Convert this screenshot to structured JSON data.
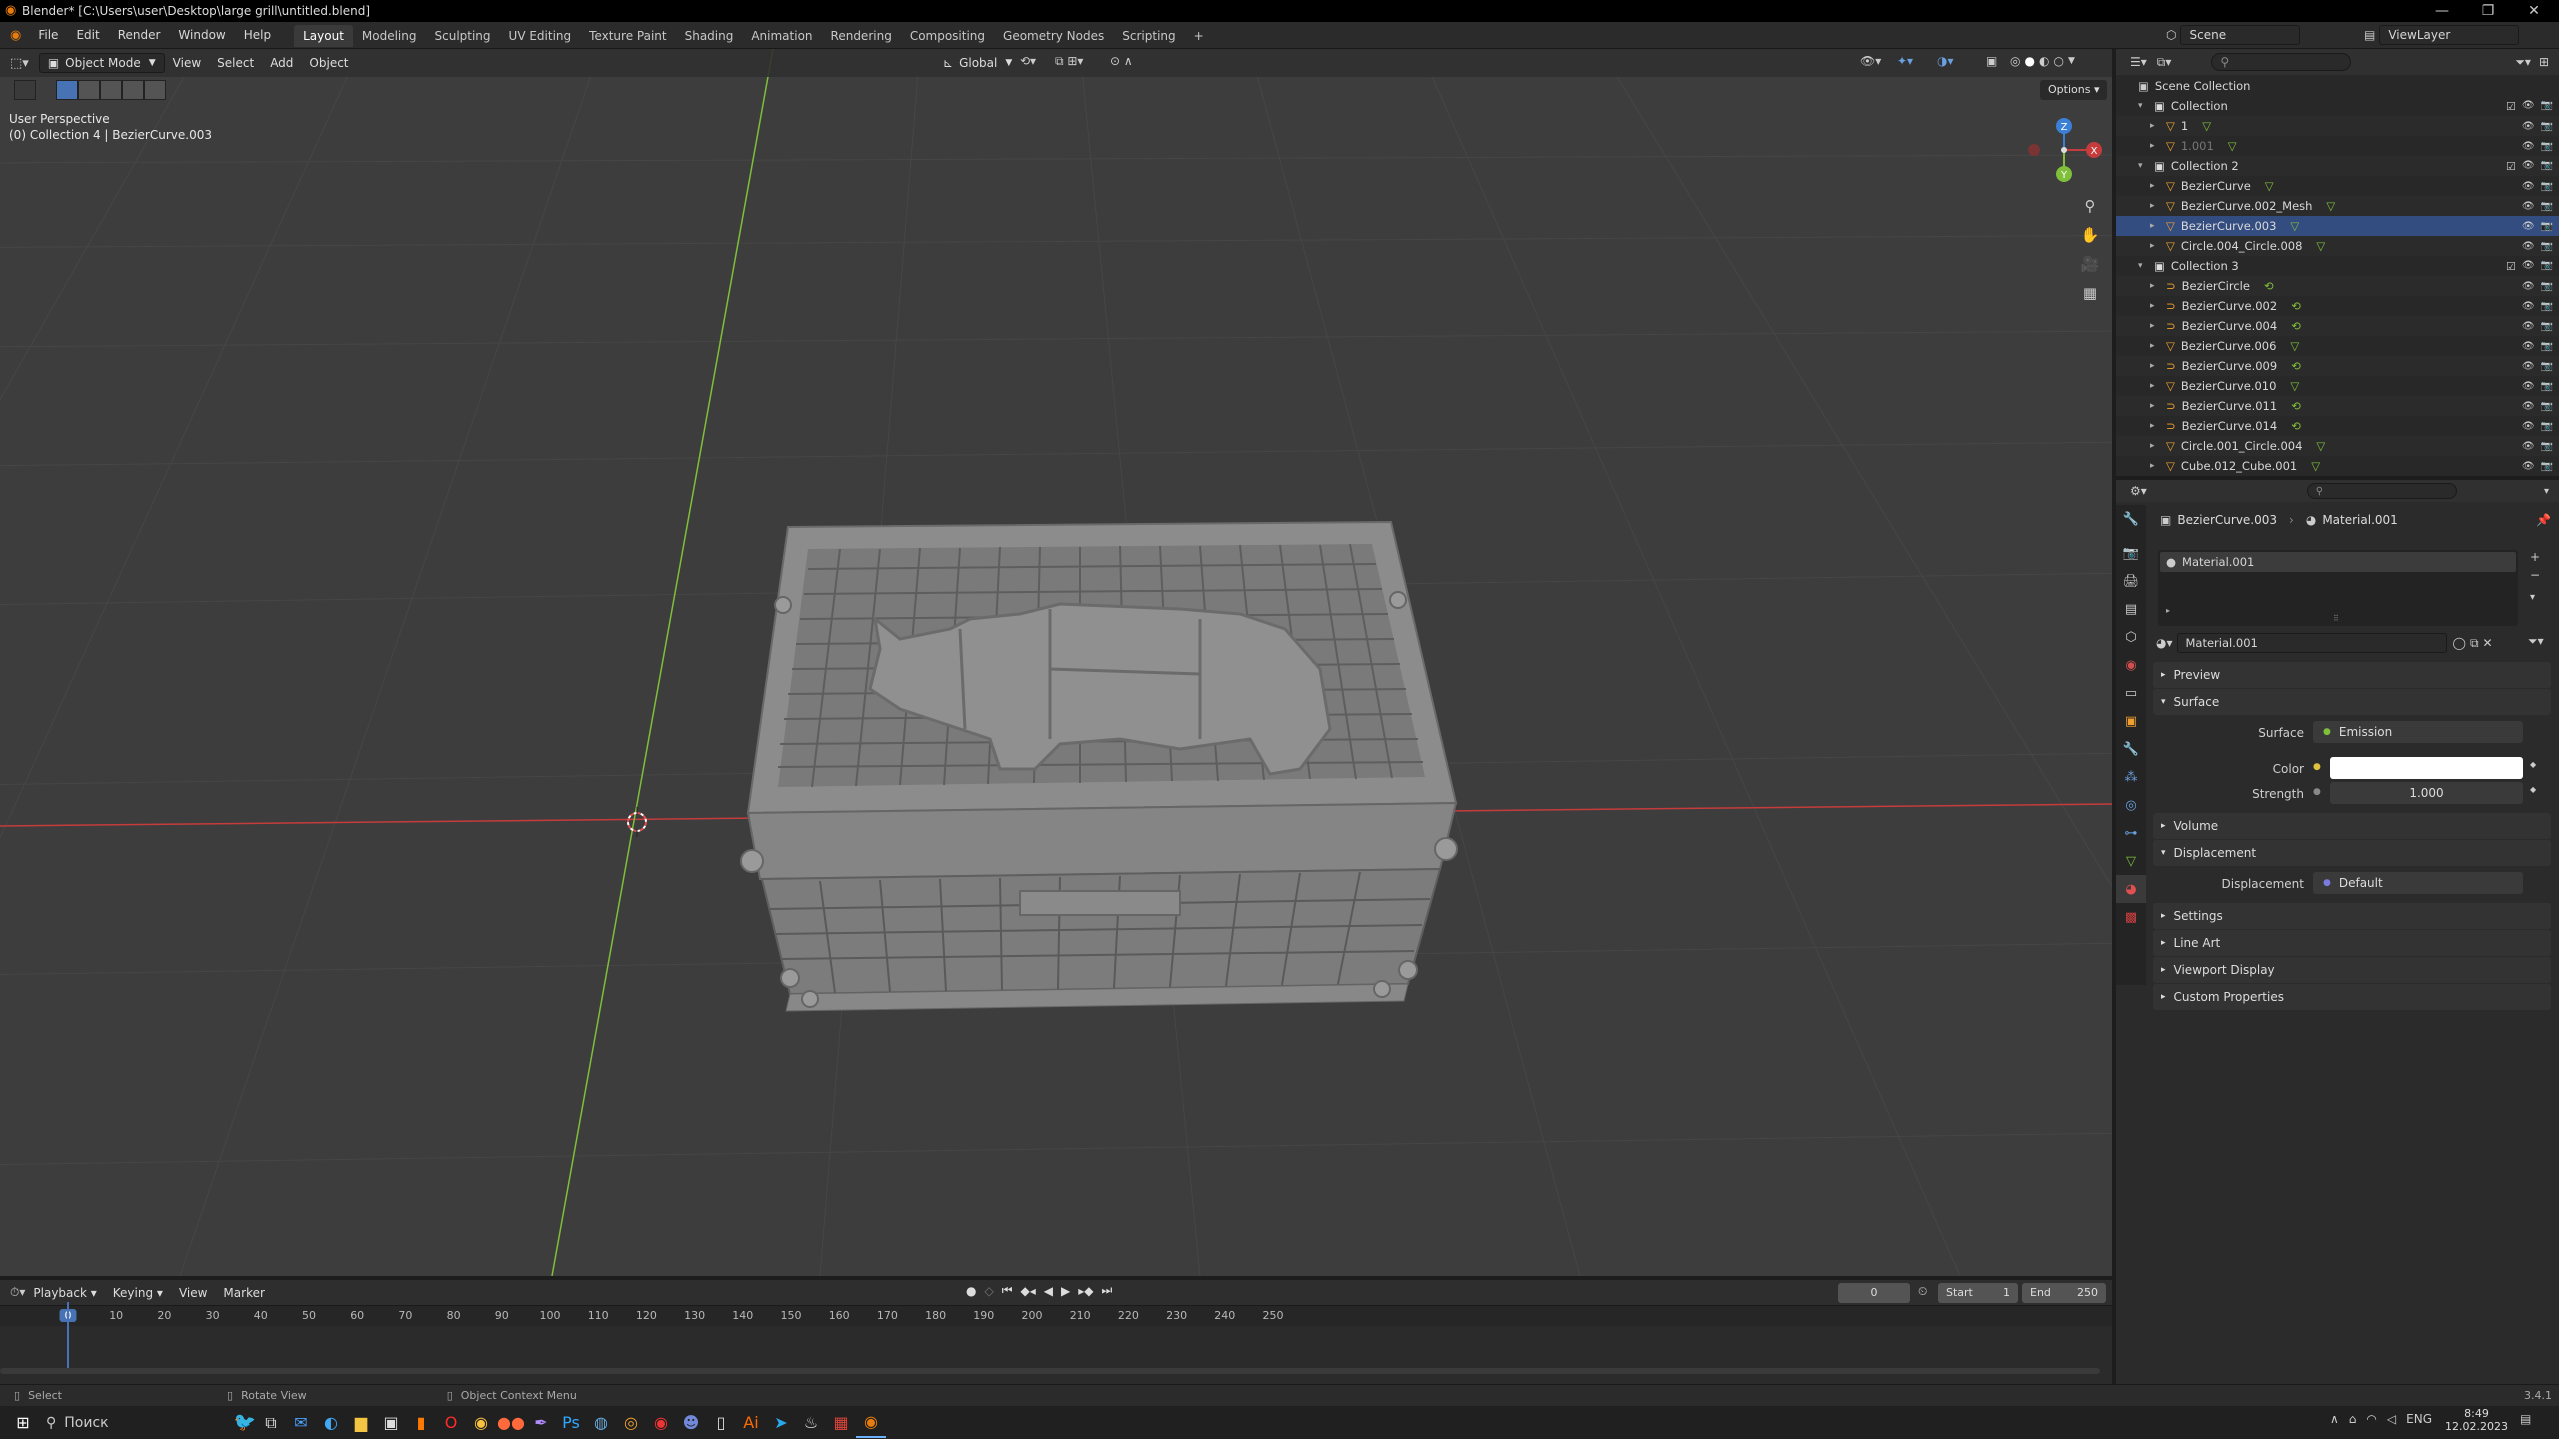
{
  "window": {
    "title": "Blender* [C:\\Users\\user\\Desktop\\large grill\\untitled.blend]"
  },
  "menu": [
    "File",
    "Edit",
    "Render",
    "Window",
    "Help"
  ],
  "workspaces": [
    "Layout",
    "Modeling",
    "Sculpting",
    "UV Editing",
    "Texture Paint",
    "Shading",
    "Animation",
    "Rendering",
    "Compositing",
    "Geometry Nodes",
    "Scripting"
  ],
  "active_workspace": "Layout",
  "scene": {
    "name": "Scene",
    "view_layer": "ViewLayer"
  },
  "viewport": {
    "mode": "Object Mode",
    "menus": [
      "View",
      "Select",
      "Add",
      "Object"
    ],
    "orientation": "Global",
    "options_label": "Options",
    "perspective_label": "User Perspective",
    "collection_label": "(0) Collection 4 | BezierCurve.003",
    "gizmo_axes": {
      "x": "X",
      "y": "Y",
      "z": "Z"
    }
  },
  "outliner": {
    "root": "Scene Collection",
    "rows": [
      {
        "indent": 1,
        "name": "Collection",
        "type": "collection"
      },
      {
        "indent": 2,
        "name": "1",
        "type": "mesh"
      },
      {
        "indent": 2,
        "name": "1.001",
        "type": "mesh",
        "dim": true
      },
      {
        "indent": 1,
        "name": "Collection 2",
        "type": "collection"
      },
      {
        "indent": 2,
        "name": "BezierCurve",
        "type": "mesh"
      },
      {
        "indent": 2,
        "name": "BezierCurve.002_Mesh",
        "type": "mesh"
      },
      {
        "indent": 2,
        "name": "BezierCurve.003",
        "type": "mesh",
        "selected": true
      },
      {
        "indent": 2,
        "name": "Circle.004_Circle.008",
        "type": "mesh"
      },
      {
        "indent": 1,
        "name": "Collection 3",
        "type": "collection"
      },
      {
        "indent": 2,
        "name": "BezierCircle",
        "type": "curve"
      },
      {
        "indent": 2,
        "name": "BezierCurve.002",
        "type": "curve"
      },
      {
        "indent": 2,
        "name": "BezierCurve.004",
        "type": "curve"
      },
      {
        "indent": 2,
        "name": "BezierCurve.006",
        "type": "mesh"
      },
      {
        "indent": 2,
        "name": "BezierCurve.009",
        "type": "curve"
      },
      {
        "indent": 2,
        "name": "BezierCurve.010",
        "type": "mesh"
      },
      {
        "indent": 2,
        "name": "BezierCurve.011",
        "type": "curve"
      },
      {
        "indent": 2,
        "name": "BezierCurve.014",
        "type": "curve"
      },
      {
        "indent": 2,
        "name": "Circle.001_Circle.004",
        "type": "mesh"
      },
      {
        "indent": 2,
        "name": "Cube.012_Cube.001",
        "type": "mesh"
      }
    ]
  },
  "properties": {
    "breadcrumb": {
      "object": "BezierCurve.003",
      "material": "Material.001"
    },
    "slot_name": "Material.001",
    "material_name": "Material.001",
    "panels": {
      "preview": "Preview",
      "surface": "Surface",
      "volume": "Volume",
      "displacement": "Displacement",
      "settings": "Settings",
      "line_art": "Line Art",
      "viewport_display": "Viewport Display",
      "custom_properties": "Custom Properties"
    },
    "surface_label": "Surface",
    "surface_value": "Emission",
    "color_label": "Color",
    "color_value": "#ffffff",
    "strength_label": "Strength",
    "strength_value": "1.000",
    "displacement_label": "Displacement",
    "displacement_value": "Default"
  },
  "timeline": {
    "menus": [
      "Playback",
      "Keying",
      "View",
      "Marker"
    ],
    "current_frame": "0",
    "start_label": "Start",
    "start": "1",
    "end_label": "End",
    "end": "250",
    "ruler_ticks": [
      "0",
      "10",
      "20",
      "30",
      "40",
      "50",
      "60",
      "70",
      "80",
      "90",
      "100",
      "110",
      "120",
      "130",
      "140",
      "150",
      "160",
      "170",
      "180",
      "190",
      "200",
      "210",
      "220",
      "230",
      "240",
      "250"
    ]
  },
  "statusbar": {
    "select": "Select",
    "rotate": "Rotate View",
    "context": "Object Context Menu",
    "version": "3.4.1"
  },
  "taskbar": {
    "search_placeholder": "Поиск",
    "lang": "ENG",
    "time": "8:49",
    "date": "12.02.2023"
  },
  "colors": {
    "accent": "#4772b3",
    "x_axis": "#c63b3b",
    "y_axis": "#7fbf3a",
    "z_axis": "#3b7fd6",
    "selected_row": "#334d80"
  }
}
